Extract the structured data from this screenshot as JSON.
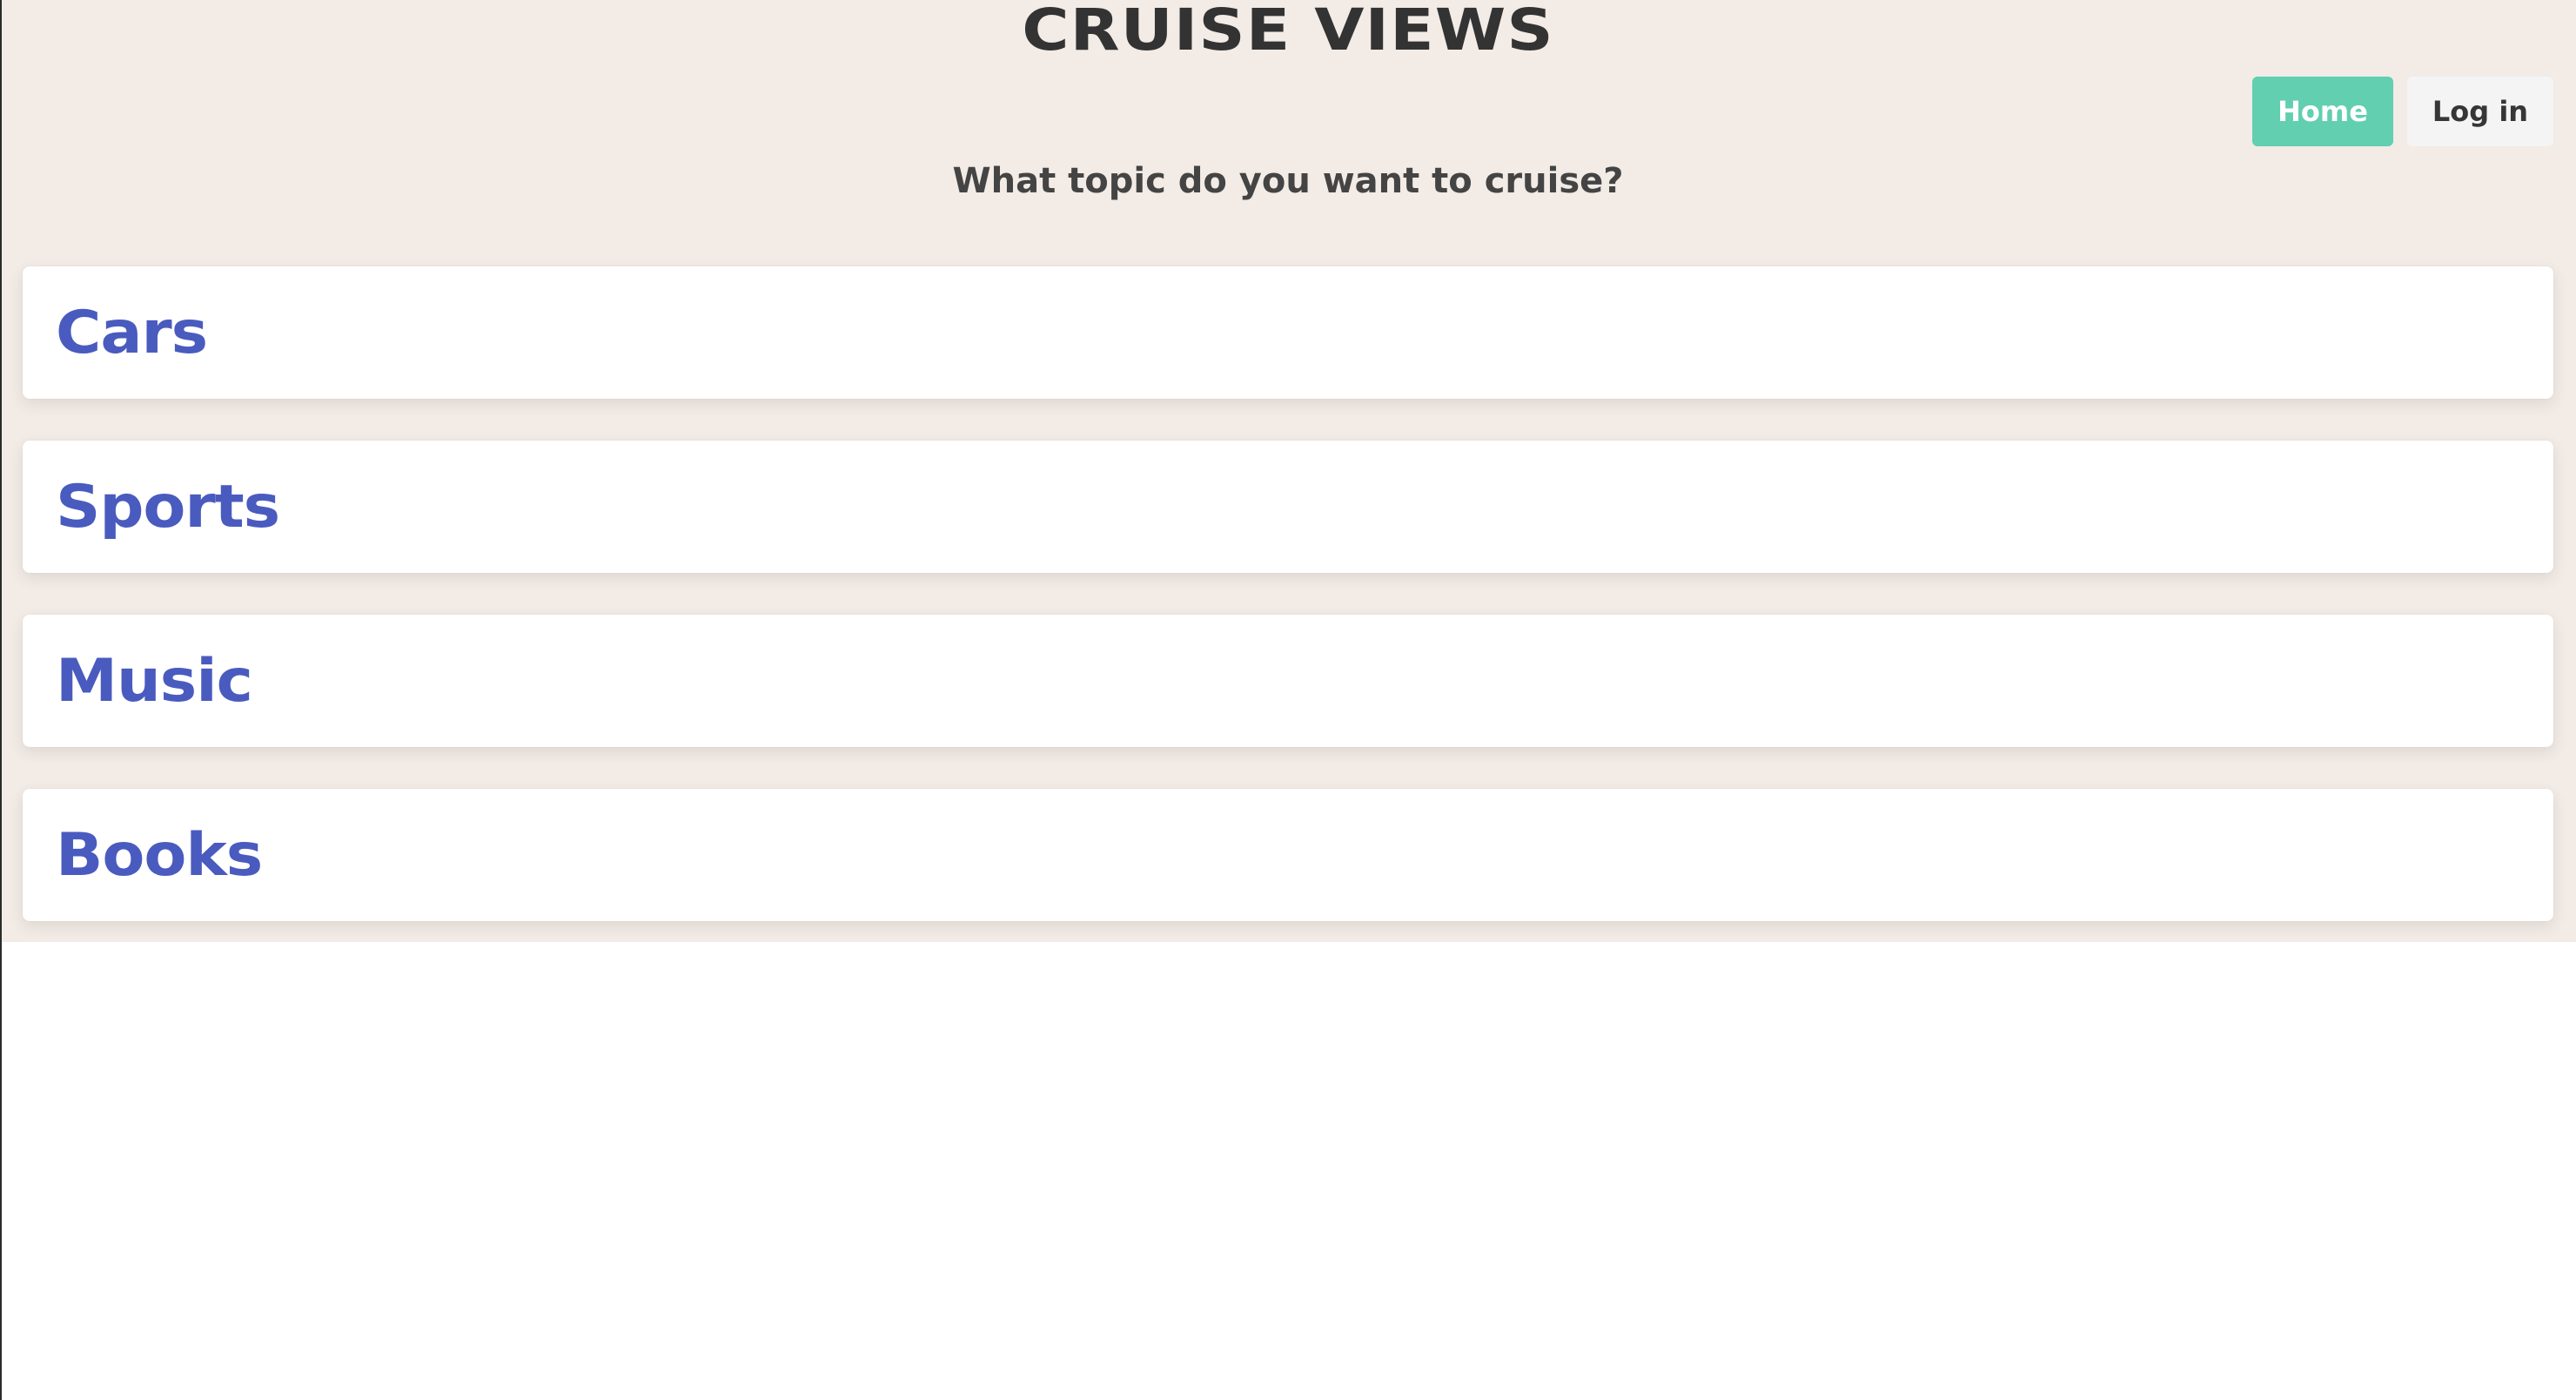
{
  "header": {
    "site_title": "CRUISE VIEWS",
    "subtitle": "What topic do you want to cruise?"
  },
  "nav": {
    "home_label": "Home",
    "login_label": "Log in"
  },
  "topics": [
    {
      "label": "Cars"
    },
    {
      "label": "Sports"
    },
    {
      "label": "Music"
    },
    {
      "label": "Books"
    }
  ],
  "colors": {
    "page_background": "#f2ebe6",
    "topic_text": "#4a5bbf",
    "home_button": "#61cfb0",
    "login_button": "#f4f4f4"
  }
}
